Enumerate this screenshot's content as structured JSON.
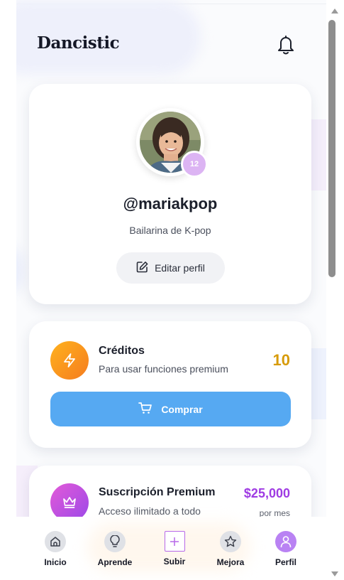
{
  "app": {
    "name": "Dancistic"
  },
  "header": {
    "notifications_icon": "bell-icon"
  },
  "profile": {
    "avatar_icon": "avatar",
    "level": "12",
    "username": "@mariakpop",
    "bio": "Bailarina de K-pop",
    "edit_label": "Editar perfil",
    "edit_icon": "edit-icon"
  },
  "credits": {
    "icon": "lightning-icon",
    "title": "Créditos",
    "subtitle": "Para usar funciones premium",
    "count": "10",
    "buy_label": "Comprar",
    "buy_icon": "cart-icon",
    "accent": "#d79b09",
    "button_color": "#56a9f2"
  },
  "subscription": {
    "icon": "crown-icon",
    "title": "Suscripción Premium",
    "description": "Acceso ilimitado a todo",
    "price": "$25,000",
    "period": "por mes",
    "accent": "#9f3be3"
  },
  "nav": {
    "items": [
      {
        "label": "Inicio",
        "icon": "home-icon"
      },
      {
        "label": "Aprende",
        "icon": "lightbulb-icon"
      },
      {
        "label": "Subir",
        "icon": "plus-icon"
      },
      {
        "label": "Mejora",
        "icon": "star-icon"
      },
      {
        "label": "Perfil",
        "icon": "user-icon",
        "active": true
      }
    ]
  }
}
